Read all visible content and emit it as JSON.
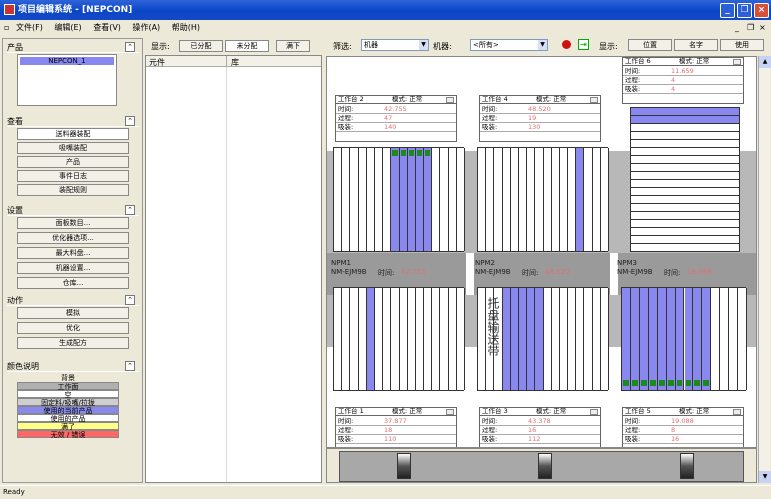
{
  "window": {
    "title": "项目编辑系统 - [NEPCON]"
  },
  "menu": [
    "文件(F)",
    "编辑(E)",
    "查看(V)",
    "操作(A)",
    "帮助(H)"
  ],
  "mdi_controls": [
    "_",
    "❐",
    "×"
  ],
  "left": {
    "product": {
      "title": "产品",
      "item": "NEPCON_1"
    },
    "view": {
      "title": "查看",
      "items": [
        "送料器装配",
        "吸嘴装配",
        "产品",
        "事件日志",
        "装配规则"
      ]
    },
    "settings": {
      "title": "设置",
      "items": [
        "面板数目...",
        "优化器选项...",
        "最大料盘...",
        "机器设置...",
        "仓库..."
      ]
    },
    "actions": {
      "title": "动作",
      "items": [
        "模拟",
        "优化",
        "生成配方"
      ]
    },
    "legend": {
      "title": "颜色说明",
      "items": [
        {
          "label": "背景",
          "color": "#ece9d8"
        },
        {
          "label": "工作面",
          "color": "#b0b0b0"
        },
        {
          "label": "空",
          "color": "#ffffff"
        },
        {
          "label": "固定料/吸嘴/拉拢",
          "color": "#cfcfcf"
        },
        {
          "label": "使用的当前产品",
          "color": "#8888ee"
        },
        {
          "label": "使用的产品",
          "color": "#ffffff"
        },
        {
          "label": "满了",
          "color": "#ffff88"
        },
        {
          "label": "无效 / 错误",
          "color": "#ff6666"
        }
      ]
    }
  },
  "middle": {
    "show_label": "显示:",
    "buttons": [
      "已分配",
      "未分配",
      "满下"
    ],
    "columns": [
      "元件",
      "库"
    ]
  },
  "toolbar": {
    "filter_label": "筛选:",
    "filter_value": "机器",
    "machine_label": "机器:",
    "machine_value": "<所有>",
    "display_label": "显示:",
    "buttons": [
      "位置",
      "名字",
      "使用"
    ]
  },
  "workstations": [
    {
      "name": "工作台 2",
      "mode": "模式: 正常",
      "time": "42.755",
      "pass": "47",
      "count": "140"
    },
    {
      "name": "工作台 4",
      "mode": "模式: 正常",
      "time": "48.520",
      "pass": "19",
      "count": "130"
    },
    {
      "name": "工作台 6",
      "mode": "模式: 正常",
      "time": "11.659",
      "pass": "4",
      "count": "4"
    },
    {
      "name": "工作台 1",
      "mode": "模式: 正常",
      "time": "37.877",
      "pass": "18",
      "count": "110"
    },
    {
      "name": "工作台 3",
      "mode": "模式: 正常",
      "time": "43.378",
      "pass": "16",
      "count": "112"
    },
    {
      "name": "工作台 5",
      "mode": "模式: 正常",
      "time": "19.088",
      "pass": "8",
      "count": "16"
    }
  ],
  "ws_row_labels": [
    "时间:",
    "过程:",
    "吸装:"
  ],
  "machines": [
    {
      "name": "NPM1",
      "model": "NM-EJM9B",
      "time_label": "时间:",
      "time": "42.755"
    },
    {
      "name": "NPM2",
      "model": "NM-EJM9B",
      "time_label": "时间:",
      "time": "48.520"
    },
    {
      "name": "NPM3",
      "model": "NM-EJM9B",
      "time_label": "时间:",
      "time": "19.088"
    }
  ],
  "tray_text": "托盘输送带",
  "status": {
    "text": "Ready"
  }
}
